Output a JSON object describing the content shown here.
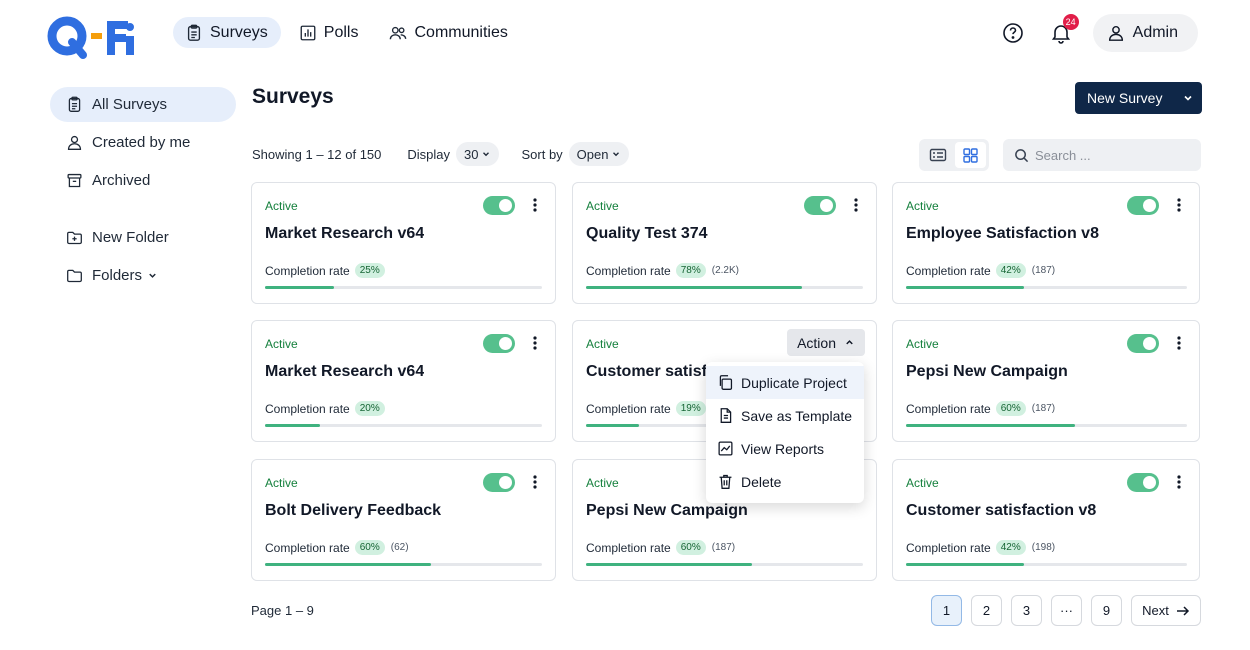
{
  "header": {
    "nav": [
      {
        "label": "Surveys",
        "icon": "clipboard-icon",
        "active": true
      },
      {
        "label": "Polls",
        "icon": "bar-chart-icon",
        "active": false
      },
      {
        "label": "Communities",
        "icon": "users-icon",
        "active": false
      }
    ],
    "notification_count": "24",
    "admin_label": "Admin"
  },
  "sidebar": {
    "items": [
      {
        "label": "All Surveys",
        "icon": "clipboard-icon"
      },
      {
        "label": "Created by me",
        "icon": "user-icon"
      },
      {
        "label": "Archived",
        "icon": "archive-icon"
      }
    ],
    "new_folder": "New Folder",
    "folders": "Folders"
  },
  "main": {
    "title": "Surveys",
    "new_survey_label": "New Survey",
    "showing": "Showing 1 – 12 of 150",
    "display_label": "Display",
    "display_value": "30",
    "sort_label": "Sort by",
    "sort_value": "Open",
    "search_placeholder": "Search ..."
  },
  "completion_label": "Completion rate",
  "cards": [
    {
      "status": "Active",
      "title": "Market Research v64",
      "rate": "25%",
      "rate_value": 25,
      "responses": ""
    },
    {
      "status": "Active",
      "title": "Quality Test 374",
      "rate": "78%",
      "rate_value": 78,
      "responses": "(2.2K)"
    },
    {
      "status": "Active",
      "title": "Employee Satisfaction v8",
      "rate": "42%",
      "rate_value": 42,
      "responses": "(187)"
    },
    {
      "status": "Active",
      "title": "Market Research v64",
      "rate": "20%",
      "rate_value": 20,
      "responses": ""
    },
    {
      "status": "Active",
      "title": "Customer satisfaction",
      "rate": "19%",
      "rate_value": 19,
      "responses": ""
    },
    {
      "status": "Active",
      "title": "Pepsi New Campaign",
      "rate": "60%",
      "rate_value": 60,
      "responses": "(187)"
    },
    {
      "status": "Active",
      "title": "Bolt Delivery Feedback",
      "rate": "60%",
      "rate_value": 60,
      "responses": "(62)"
    },
    {
      "status": "Active",
      "title": "Pepsi New Campaign",
      "rate": "60%",
      "rate_value": 60,
      "responses": "(187)"
    },
    {
      "status": "Active",
      "title": "Customer satisfaction v8",
      "rate": "42%",
      "rate_value": 42,
      "responses": "(198)"
    }
  ],
  "action_button_label": "Action",
  "action_menu": [
    {
      "label": "Duplicate Project",
      "icon": "copy-icon"
    },
    {
      "label": "Save as Template",
      "icon": "file-icon"
    },
    {
      "label": "View Reports",
      "icon": "chart-line-icon"
    },
    {
      "label": "Delete",
      "icon": "trash-icon"
    }
  ],
  "pagination": {
    "info": "Page 1 – 9",
    "pages": [
      "1",
      "2",
      "3",
      "···",
      "9"
    ],
    "next": "Next"
  },
  "colors": {
    "accent": "#0f2748",
    "active_nav": "#e6eefb",
    "status_green": "#15803d",
    "toggle_on": "#56c08d",
    "progress": "#3fb27f"
  }
}
